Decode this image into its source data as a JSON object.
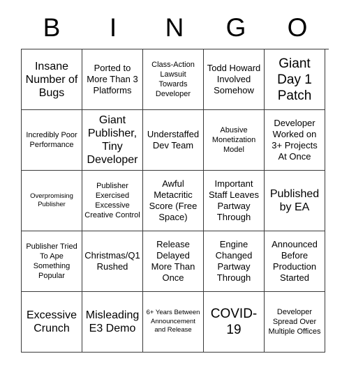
{
  "card": {
    "header_letters": [
      "B",
      "I",
      "N",
      "G",
      "O"
    ],
    "rows": [
      [
        {
          "text": "Insane Number of Bugs",
          "size": "fs-lg"
        },
        {
          "text": "Ported to More Than 3 Platforms",
          "size": "fs-md"
        },
        {
          "text": "Class-Action Lawsuit Towards Developer",
          "size": "fs-sm"
        },
        {
          "text": "Todd Howard Involved Somehow",
          "size": "fs-md"
        },
        {
          "text": "Giant Day 1 Patch",
          "size": "fs-xl"
        }
      ],
      [
        {
          "text": "Incredibly Poor Performance",
          "size": "fs-sm"
        },
        {
          "text": "Giant Publisher, Tiny Developer",
          "size": "fs-lg"
        },
        {
          "text": "Understaffed Dev Team",
          "size": "fs-md"
        },
        {
          "text": "Abusive Monetization Model",
          "size": "fs-sm"
        },
        {
          "text": "Developer Worked on 3+ Projects At Once",
          "size": "fs-md"
        }
      ],
      [
        {
          "text": "Overpromising Publisher",
          "size": "fs-xs"
        },
        {
          "text": "Publisher Exercised Excessive Creative Control",
          "size": "fs-sm"
        },
        {
          "text": "Awful Metacritic Score (Free Space)",
          "size": "fs-md"
        },
        {
          "text": "Important Staff Leaves Partway Through",
          "size": "fs-md"
        },
        {
          "text": "Published by EA",
          "size": "fs-lg"
        }
      ],
      [
        {
          "text": "Publisher Tried To Ape Something Popular",
          "size": "fs-sm"
        },
        {
          "text": "Christmas/Q1 Rushed",
          "size": "fs-md"
        },
        {
          "text": "Release Delayed More Than Once",
          "size": "fs-md"
        },
        {
          "text": "Engine Changed Partway Through",
          "size": "fs-md"
        },
        {
          "text": "Announced Before Production Started",
          "size": "fs-md"
        }
      ],
      [
        {
          "text": "Excessive Crunch",
          "size": "fs-lg"
        },
        {
          "text": "Misleading E3 Demo",
          "size": "fs-lg"
        },
        {
          "text": "6+ Years Between Announcement and Release",
          "size": "fs-xs"
        },
        {
          "text": "COVID-19",
          "size": "fs-xl"
        },
        {
          "text": "Developer Spread Over Multiple Offices",
          "size": "fs-sm"
        }
      ]
    ]
  },
  "colors": {
    "background": "#ffffff",
    "text": "#000000",
    "grid_border": "#3a3a3a"
  }
}
